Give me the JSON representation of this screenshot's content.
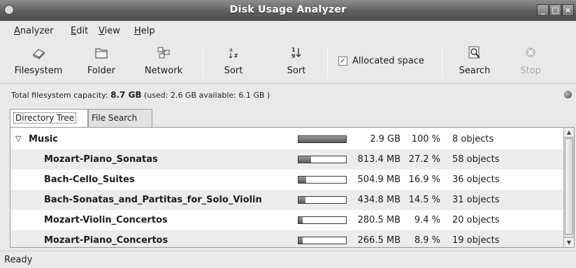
{
  "window": {
    "title": "Disk Usage Analyzer",
    "controls": [
      "_",
      "□",
      "×"
    ]
  },
  "menu": [
    "Analyzer",
    "Edit",
    "View",
    "Help"
  ],
  "toolbar": {
    "filesystem": "Filesystem",
    "folder": "Folder",
    "network": "Network",
    "sort_az": "Sort",
    "sort_19": "Sort",
    "allocated_space": "Allocated space",
    "allocated_checked": "✓",
    "search": "Search",
    "stop": "Stop"
  },
  "capacity": {
    "prefix": "Total filesystem capacity:",
    "total": "8.7 GB",
    "detail": "(used: 2.6 GB available: 6.1 GB )"
  },
  "tabs": [
    "Directory Tree",
    "File Search"
  ],
  "tree": {
    "rows": [
      {
        "name": "Music",
        "size": "2.9 GB",
        "percent": "100 %",
        "objects": "8 objects",
        "fill": 1.0
      },
      {
        "name": "Mozart-Piano_Sonatas",
        "size": "813.4 MB",
        "percent": "27.2 %",
        "objects": "58 objects",
        "fill": 0.272
      },
      {
        "name": "Bach-Cello_Suites",
        "size": "504.9 MB",
        "percent": "16.9 %",
        "objects": "36 objects",
        "fill": 0.169
      },
      {
        "name": "Bach-Sonatas_and_Partitas_for_Solo_Violin",
        "size": "434.8 MB",
        "percent": "14.5 %",
        "objects": "31 objects",
        "fill": 0.145
      },
      {
        "name": "Mozart-Violin_Concertos",
        "size": "280.5 MB",
        "percent": "9.4 %",
        "objects": "20 objects",
        "fill": 0.094
      },
      {
        "name": "Mozart-Piano_Concertos",
        "size": "266.5 MB",
        "percent": "8.9 %",
        "objects": "19 objects",
        "fill": 0.089
      }
    ]
  },
  "status": "Ready"
}
